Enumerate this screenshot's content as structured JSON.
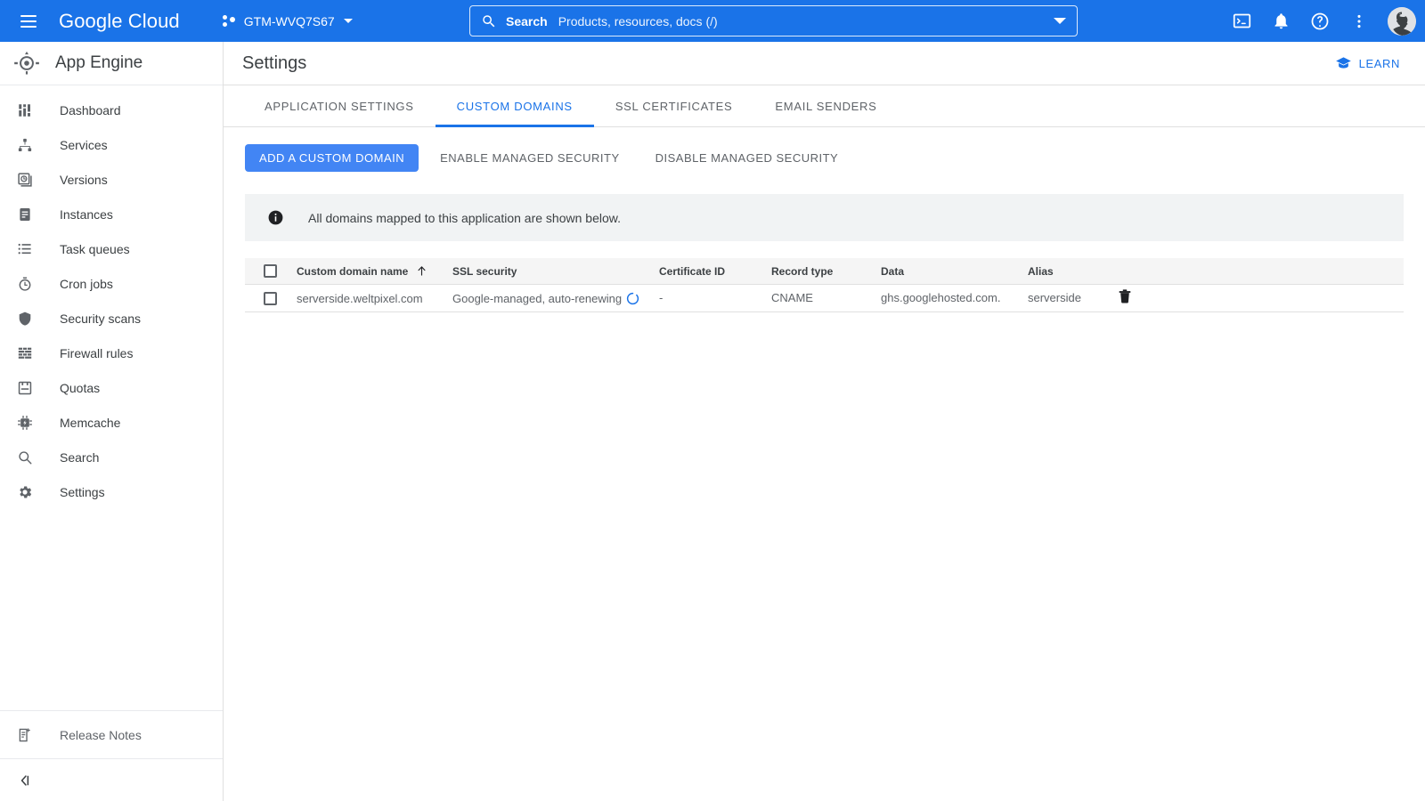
{
  "topbar": {
    "menu_icon": "hamburger-icon",
    "brand": "Google Cloud",
    "project": {
      "icon": "project-dots-icon",
      "name": "GTM-WVQ7S67",
      "caret": "chevron-down-icon"
    },
    "search": {
      "icon": "search-icon",
      "label": "Search",
      "placeholder": "Products, resources, docs (/)",
      "chevron": "chevron-down-icon"
    },
    "actions": [
      {
        "name": "cloud-shell-icon",
        "title": "Activate Cloud Shell"
      },
      {
        "name": "notifications-bell-icon",
        "title": "Notifications"
      },
      {
        "name": "help-icon",
        "title": "Help"
      },
      {
        "name": "more-options-icon",
        "title": "More options"
      }
    ],
    "avatar": "user-avatar"
  },
  "sidebar": {
    "product_icon": "app-engine-icon",
    "product_name": "App Engine",
    "items": [
      {
        "icon": "dashboard-icon",
        "label": "Dashboard"
      },
      {
        "icon": "services-icon",
        "label": "Services"
      },
      {
        "icon": "versions-icon",
        "label": "Versions"
      },
      {
        "icon": "instances-icon",
        "label": "Instances"
      },
      {
        "icon": "task-queues-icon",
        "label": "Task queues"
      },
      {
        "icon": "cron-jobs-icon",
        "label": "Cron jobs"
      },
      {
        "icon": "security-scans-icon",
        "label": "Security scans"
      },
      {
        "icon": "firewall-rules-icon",
        "label": "Firewall rules"
      },
      {
        "icon": "quotas-icon",
        "label": "Quotas"
      },
      {
        "icon": "memcache-icon",
        "label": "Memcache"
      },
      {
        "icon": "search-icon",
        "label": "Search"
      },
      {
        "icon": "settings-gear-icon",
        "label": "Settings"
      }
    ],
    "release_notes": {
      "icon": "release-notes-icon",
      "label": "Release Notes"
    },
    "collapse": {
      "icon": "collapse-panel-icon"
    }
  },
  "page": {
    "title": "Settings",
    "learn": {
      "icon": "graduation-cap-icon",
      "label": "LEARN"
    }
  },
  "tabs": [
    {
      "label": "APPLICATION SETTINGS",
      "active": false
    },
    {
      "label": "CUSTOM DOMAINS",
      "active": true
    },
    {
      "label": "SSL CERTIFICATES",
      "active": false
    },
    {
      "label": "EMAIL SENDERS",
      "active": false
    }
  ],
  "toolbar": {
    "add_domain_label": "ADD A CUSTOM DOMAIN",
    "enable_security_label": "ENABLE MANAGED SECURITY",
    "disable_security_label": "DISABLE MANAGED SECURITY"
  },
  "banner": {
    "icon": "info-icon",
    "text": "All domains mapped to this application are shown below."
  },
  "table": {
    "columns": [
      "Custom domain name",
      "SSL security",
      "Certificate ID",
      "Record type",
      "Data",
      "Alias"
    ],
    "sort_column": "Custom domain name",
    "sort_icon": "arrow-up-icon",
    "rows": [
      {
        "domain": "serverside.weltpixel.com",
        "ssl_security": "Google-managed, auto-renewing",
        "ssl_status_icon": "loading-spinner-icon",
        "certificate_id": "-",
        "record_type": "CNAME",
        "data": "ghs.googlehosted.com.",
        "alias": "serverside",
        "delete_icon": "trash-icon"
      }
    ]
  },
  "colors": {
    "brand_blue": "#1a73e8",
    "button_blue": "#4285f4",
    "text_primary": "#3c4043",
    "text_secondary": "#5f6368",
    "banner_bg": "#f1f3f4",
    "table_header_bg": "#f5f5f5",
    "border": "#e0e0e0"
  }
}
